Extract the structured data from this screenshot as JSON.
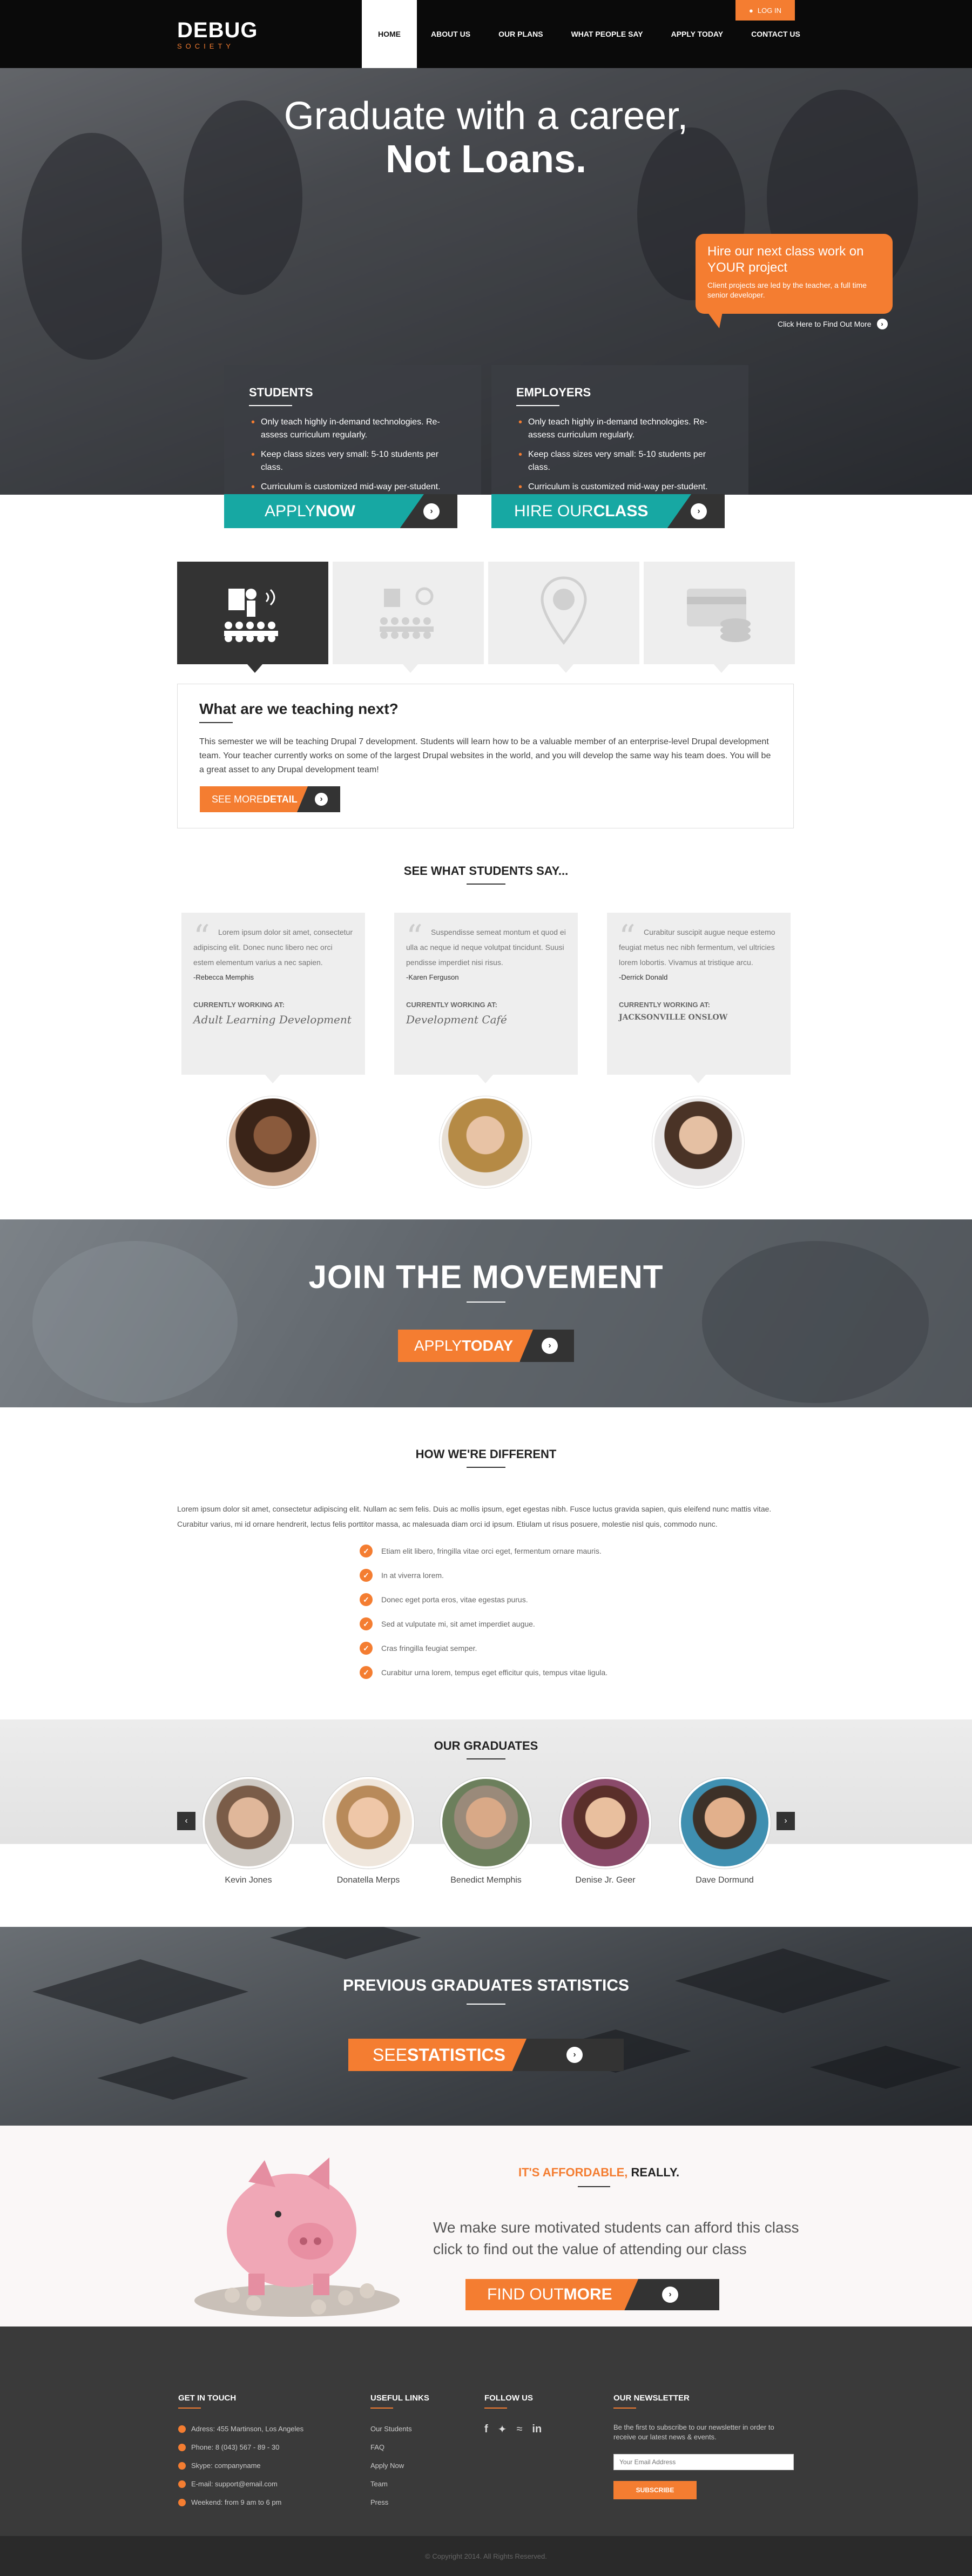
{
  "header": {
    "logo_line1": "DEBUG",
    "logo_line2": "SOCIETY",
    "login": "LOG IN",
    "nav": [
      {
        "label": "HOME"
      },
      {
        "label": "ABOUT US"
      },
      {
        "label": "OUR PLANS"
      },
      {
        "label": "WHAT PEOPLE SAY"
      },
      {
        "label": "APPLY TODAY"
      },
      {
        "label": "CONTACT US"
      }
    ]
  },
  "hero": {
    "title_line1": "Graduate with a career,",
    "title_line2": "Not Loans.",
    "bubble_title": "Hire our next class work on YOUR project",
    "bubble_text": "Client projects are led by the teacher, a full time senior developer.",
    "find_more": "Click Here to Find Out More",
    "students": {
      "title": "STUDENTS",
      "items": [
        "Only teach highly in-demand technologies. Re-assess curriculum regularly.",
        "Keep class sizes very small: 5-10 students per class.",
        "Curriculum is customized mid-way per-student."
      ],
      "cta_light": "APPLY ",
      "cta_bold": "NOW"
    },
    "employers": {
      "title": "EMPLOYERS",
      "items": [
        "Only teach highly in-demand technologies. Re-assess curriculum regularly.",
        "Keep class sizes very small: 5-10 students per class.",
        "Curriculum is customized mid-way per-student."
      ],
      "cta_light": "HIRE OUR ",
      "cta_bold": "CLASS"
    }
  },
  "teaching": {
    "title": "What are we teaching next?",
    "text": "This semester we will be teaching Drupal 7 development. Students will learn how to be a valuable member of an enterprise-level Drupal development team. Your teacher currently works on some of the largest Drupal websites in the world, and you will develop the same way his team does. You will be a great asset to any Drupal development team!",
    "btn_light": "SEE MORE ",
    "btn_bold": "DETAIL"
  },
  "testimonials": {
    "title": "SEE WHAT STUDENTS SAY...",
    "items": [
      {
        "quote": "Lorem ipsum dolor sit amet, consectetur adipiscing elit. Donec nunc libero nec orci estem elementum varius a nec sapien.",
        "author": "-Rebecca Memphis",
        "company": "Adult Learning Development"
      },
      {
        "quote": "Suspendisse semeat montum et quod ei ulla ac neque id neque volutpat tincidunt. Suusi pendisse imperdiet nisi risus.",
        "author": "-Karen Ferguson",
        "company": "Development Café"
      },
      {
        "quote": "Curabitur suscipit augue neque estemo feugiat metus nec nibh fermentum, vel ultricies lorem lobortis. Vivamus at tristique arcu.",
        "author": "-Derrick Donald",
        "company": "JACKSONVILLE ONSLOW"
      }
    ],
    "working_at": "CURRENTLY WORKING AT:"
  },
  "join": {
    "title": "JOIN THE MOVEMENT",
    "btn_light": "APPLY ",
    "btn_bold": "TODAY"
  },
  "different": {
    "title": "HOW WE'RE DIFFERENT",
    "text": "Lorem ipsum dolor sit amet, consectetur adipiscing elit. Nullam ac sem felis. Duis ac mollis ipsum, eget egestas nibh. Fusce luctus gravida sapien, quis eleifend nunc mattis vitae. Curabitur varius, mi id ornare hendrerit, lectus felis porttitor massa, ac malesuada diam orci id ipsum. Etiulam ut risus posuere, molestie nisl quis, commodo nunc.",
    "items": [
      "Etiam elit libero, fringilla vitae orci eget, fermentum ornare mauris.",
      "In at viverra lorem.",
      "Donec eget porta eros, vitae egestas purus.",
      "Sed at vulputate mi, sit amet imperdiet augue.",
      "Cras fringilla feugiat semper.",
      "Curabitur urna lorem, tempus eget efficitur quis, tempus vitae ligula."
    ]
  },
  "graduates": {
    "title": "OUR GRADUATES",
    "names": [
      "Kevin Jones",
      "Donatella Merps",
      "Benedict Memphis",
      "Denise Jr. Geer",
      "Dave Dormund"
    ]
  },
  "stats": {
    "title": "PREVIOUS GRADUATES STATISTICS",
    "btn_light": "SEE ",
    "btn_bold": "STATISTICS"
  },
  "affordable": {
    "title_orange": "IT'S AFFORDABLE,",
    "title_dark": " REALLY.",
    "text": "We make sure motivated students can afford this class click to find out the value of attending our class",
    "btn_light": "FIND OUT ",
    "btn_bold": "MORE"
  },
  "footer": {
    "contact_title": "GET IN TOUCH",
    "contact": [
      "Adress: 455 Martinson, Los Angeles",
      "Phone: 8 (043) 567 - 89 - 30",
      "Skype: companyname",
      "E-mail: support@email.com",
      "Weekend: from 9 am to 6 pm"
    ],
    "links_title": "USEFUL LINKS",
    "links": [
      "Our Students",
      "FAQ",
      "Apply Now",
      "Team",
      "Press"
    ],
    "follow_title": "FOLLOW US",
    "newsletter_title": "OUR NEWSLETTER",
    "newsletter_text": "Be the first to subscribe to our newsletter in order to receive our latest news & events.",
    "email_placeholder": "Your Email Address",
    "subscribe": "SUBSCRIBE",
    "copyright": "© Copyright 2014. All Rights Reserved."
  },
  "colors": {
    "accent": "#f47d31",
    "teal": "#17a8a3",
    "dark": "#333333"
  }
}
